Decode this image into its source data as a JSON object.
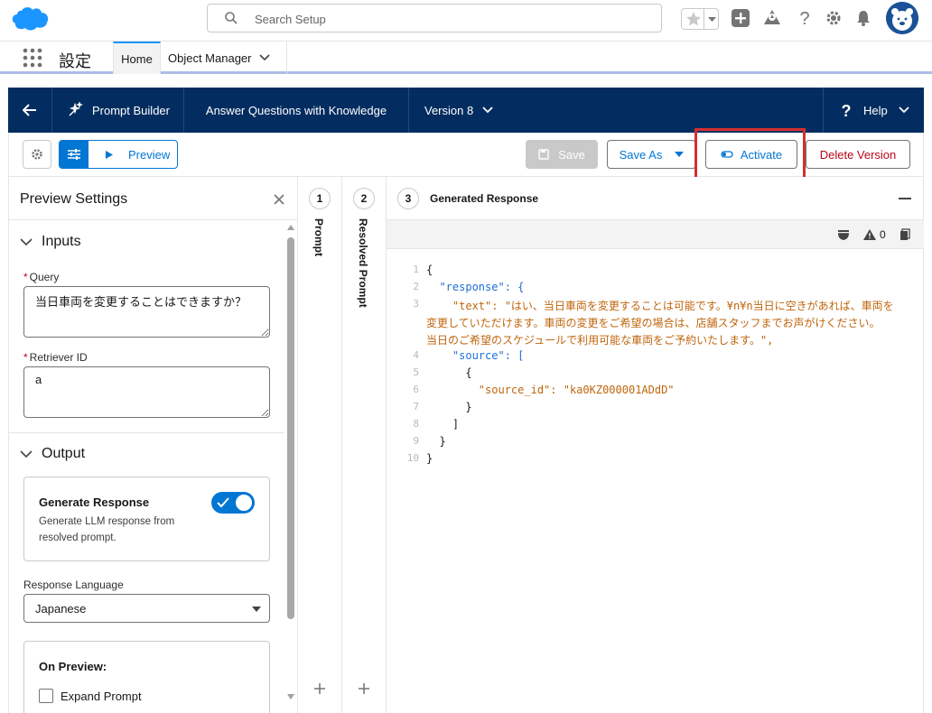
{
  "global_header": {
    "search_placeholder": "Search Setup",
    "icons": [
      "salesforce-cloud-icon",
      "search-icon",
      "star-icon",
      "chevron-down-icon",
      "plus-icon",
      "trailhead-icon",
      "help-icon",
      "gear-icon",
      "bell-icon",
      "avatar"
    ]
  },
  "app_nav": {
    "app_name": "設定",
    "tabs": [
      {
        "label": "Home"
      },
      {
        "label": "Object Manager"
      }
    ]
  },
  "builder_header": {
    "app_title": "Prompt Builder",
    "template_name": "Answer Questions with Knowledge",
    "version_label": "Version 8",
    "help_label": "Help"
  },
  "toolbar": {
    "preview_label": "Preview",
    "save_label": "Save",
    "save_as_label": "Save As",
    "activate_label": "Activate",
    "delete_label": "Delete Version",
    "highlight_color": "#d32f2f"
  },
  "preview_settings": {
    "title": "Preview Settings",
    "inputs_section": "Inputs",
    "query_label": "Query",
    "query_value": "当日車両を変更することはできますか？",
    "retriever_label": "Retriever ID",
    "retriever_value": "a",
    "output_section": "Output",
    "generate_title": "Generate Response",
    "generate_desc_1": "Generate LLM response from",
    "generate_desc_2": "resolved prompt.",
    "generate_enabled": true,
    "language_label": "Response Language",
    "language_value": "Japanese",
    "on_preview_title": "On Preview:",
    "expand_prompt_label": "Expand Prompt",
    "expand_prompt_checked": false
  },
  "step_columns": [
    {
      "number": "1",
      "label": "Prompt"
    },
    {
      "number": "2",
      "label": "Resolved Prompt"
    }
  ],
  "response": {
    "number": "3",
    "title": "Generated Response",
    "warning_count": "0",
    "code_lines": [
      {
        "n": "1",
        "text": "{"
      },
      {
        "n": "2",
        "text": "  \"response\": {"
      },
      {
        "n": "3",
        "text": "    \"text\": \"はい、当日車両を変更することは可能です。¥n¥n当日に空きがあれば、車両を"
      },
      {
        "n": "",
        "text": "変更していただけます。車両の変更をご希望の場合は、店舗スタッフまでお声がけください。"
      },
      {
        "n": "",
        "text": "当日のご希望のスケジュールで利用可能な車両をご予約いたします。\","
      },
      {
        "n": "4",
        "text": "    \"source\": ["
      },
      {
        "n": "5",
        "text": "      {"
      },
      {
        "n": "6",
        "text": "        \"source_id\": \"ka0KZ000001ADdD\""
      },
      {
        "n": "7",
        "text": "      }"
      },
      {
        "n": "8",
        "text": "    ]"
      },
      {
        "n": "9",
        "text": "  }"
      },
      {
        "n": "10",
        "text": "}"
      }
    ]
  }
}
